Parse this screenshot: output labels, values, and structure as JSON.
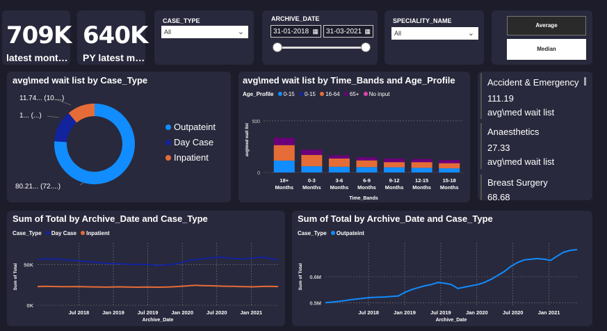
{
  "kpis": [
    {
      "value": "709K",
      "label": "latest mont…"
    },
    {
      "value": "640K",
      "label": "PY latest m…"
    }
  ],
  "slicers": {
    "case_type": {
      "title": "CASE_TYPE",
      "value": "All"
    },
    "archive_date": {
      "title": "ARCHIVE_DATE",
      "start": "31-01-2018",
      "end": "31-03-2021"
    },
    "speciality": {
      "title": "SPECIALITY_NAME",
      "value": "All"
    }
  },
  "toggle": {
    "average": "Average",
    "median": "Median"
  },
  "donut": {
    "title": "avg\\med wait list by Case_Type",
    "labels": [
      "11.74... (10....)",
      "1... (...)",
      "80.21... (72....)"
    ],
    "legend": [
      {
        "name": "Outpateint",
        "color": "#118dff"
      },
      {
        "name": "Day Case",
        "color": "#12239e"
      },
      {
        "name": "Inpatient",
        "color": "#e66c37"
      }
    ]
  },
  "speciality_cards": [
    {
      "name": "Accident & Emergency",
      "value": "111.19",
      "sub": "avg\\med wait list"
    },
    {
      "name": "Anaesthetics",
      "value": "27.33",
      "sub": "avg\\med wait list"
    },
    {
      "name": "Breast Surgery",
      "value": "68.68",
      "sub": ""
    }
  ],
  "colors": {
    "blue": "#118dff",
    "dark_blue": "#12239e",
    "orange": "#e66c37",
    "purple": "#6b007b",
    "magenta": "#e044a7",
    "bg": "#1c1c2b",
    "card": "#29293d"
  },
  "chart_data": [
    {
      "type": "pie",
      "title": "avg\\med wait list by Case_Type",
      "categories": [
        "Outpateint",
        "Day Case",
        "Inpatient"
      ],
      "values": [
        80.21,
        13.5,
        11.74
      ]
    },
    {
      "type": "bar",
      "title": "avg\\med wait list by Time_Bands and Age_Profile",
      "legend_title": "Age_Profile",
      "xlabel": "Time_Bands",
      "ylabel": "avg\\med wait list",
      "ylim": [
        0,
        600
      ],
      "yticks": [
        "0",
        "500"
      ],
      "categories": [
        "18+ Months",
        "0-3 Months",
        "3-6 Months",
        "6-9 Months",
        "9-12 Months",
        "12-15 Months",
        "15-18 Months"
      ],
      "series": [
        {
          "name": "0-15",
          "color": "#118dff",
          "values": [
            115,
            60,
            55,
            52,
            50,
            45,
            40
          ]
        },
        {
          "name": "0-15",
          "color": "#12239e",
          "values": [
            0,
            0,
            0,
            0,
            0,
            0,
            0
          ]
        },
        {
          "name": "16-64",
          "color": "#e66c37",
          "values": [
            150,
            110,
            80,
            65,
            50,
            55,
            50
          ]
        },
        {
          "name": "65+",
          "color": "#6b007b",
          "values": [
            70,
            50,
            30,
            30,
            35,
            30,
            30
          ]
        },
        {
          "name": "No input",
          "color": "#e044a7",
          "values": [
            0,
            0,
            0,
            0,
            0,
            0,
            0
          ]
        }
      ],
      "grid": true
    },
    {
      "type": "line",
      "title": "Sum of Total by Archive_Date and Case_Type",
      "legend_title": "Case_Type",
      "xlabel": "Archive_Date",
      "ylabel": "Sum of Total",
      "x_ticks": [
        "Jul 2018",
        "Jan 2019",
        "Jul 2019",
        "Jan 2020",
        "Jul 2020",
        "Jan 2021"
      ],
      "y_ticks": [
        "0K",
        "50K"
      ],
      "ylim": [
        0,
        70000
      ],
      "series": [
        {
          "name": "Day Case",
          "color": "#12239e",
          "values": [
            56000,
            57000,
            56500,
            57000,
            56000,
            55500,
            55000,
            54000,
            53500,
            53000,
            52000,
            51500,
            51000,
            51000,
            50500,
            50000,
            50000,
            50000,
            49500,
            49000,
            49500,
            50000,
            51000,
            53000,
            55000,
            56000,
            57000,
            58000,
            58500,
            59000,
            58000,
            57500,
            57000,
            57000,
            58000,
            59000,
            58500,
            57000,
            56000
          ]
        },
        {
          "name": "Inpatient",
          "color": "#e66c37",
          "values": [
            23000,
            23200,
            23100,
            23000,
            22800,
            22900,
            23000,
            22800,
            22600,
            22500,
            22400,
            22300,
            22500,
            22600,
            22400,
            22300,
            22200,
            22400,
            22300,
            22200,
            22300,
            22500,
            23000,
            23500,
            24000,
            24500,
            24200,
            24000,
            23800,
            23500,
            23300,
            23200,
            23000,
            22800,
            22600,
            23000,
            23200,
            23100,
            23000
          ]
        }
      ],
      "grid": true
    },
    {
      "type": "line",
      "title": "Sum of Total by Archive_Date and Case_Type",
      "legend_title": "Case_Type",
      "xlabel": "Archive_Date",
      "ylabel": "Sum of Total",
      "x_ticks": [
        "Jul 2018",
        "Jan 2019",
        "Jul 2019",
        "Jan 2020",
        "Jul 2020",
        "Jan 2021"
      ],
      "y_ticks": [
        "0.5M",
        "0.6M"
      ],
      "ylim": [
        0.49,
        0.71
      ],
      "series": [
        {
          "name": "Outpateint",
          "color": "#118dff",
          "values": [
            0.5,
            0.502,
            0.505,
            0.508,
            0.512,
            0.515,
            0.518,
            0.52,
            0.521,
            0.522,
            0.524,
            0.526,
            0.54,
            0.55,
            0.558,
            0.565,
            0.57,
            0.578,
            0.575,
            0.57,
            0.555,
            0.56,
            0.565,
            0.57,
            0.578,
            0.59,
            0.605,
            0.62,
            0.64,
            0.655,
            0.665,
            0.668,
            0.67,
            0.668,
            0.663,
            0.68,
            0.695,
            0.702,
            0.705
          ]
        }
      ],
      "grid": true
    }
  ]
}
